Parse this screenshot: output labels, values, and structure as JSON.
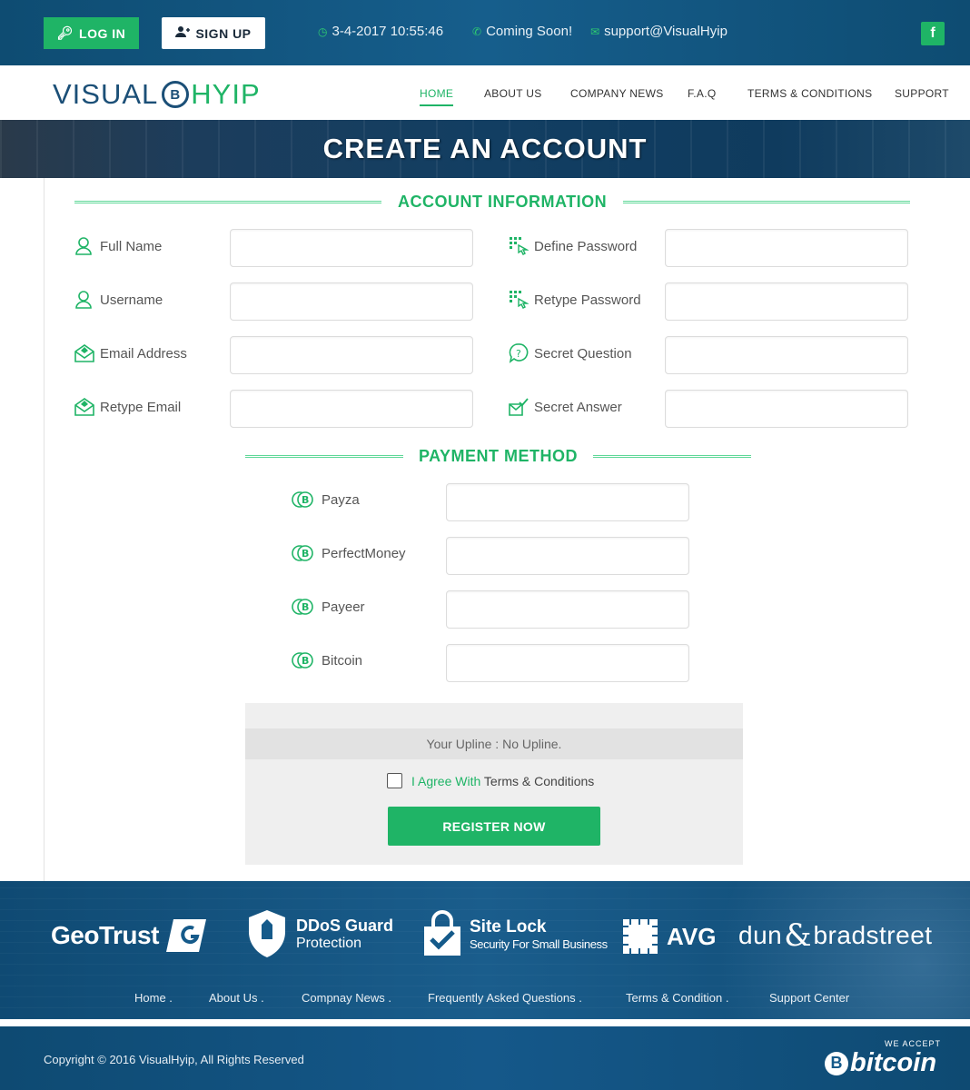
{
  "topbar": {
    "login_label": "LOG IN",
    "signup_label": "SIGN UP",
    "datetime": "3-4-2017 10:55:46",
    "phone": "Coming Soon!",
    "email": "support@VisualHyip",
    "facebook": "f"
  },
  "logo": {
    "part1": "VISUAL",
    "coin": "B",
    "part2": "HYIP"
  },
  "nav": {
    "home": "HOME",
    "about": "ABOUT US",
    "news": "COMPANY NEWS",
    "faq": "F.A.Q",
    "terms": "TERMS & CONDITIONS",
    "support": "SUPPORT"
  },
  "banner": {
    "title": "CREATE AN ACCOUNT"
  },
  "account_section": {
    "title": "ACCOUNT INFORMATION",
    "full_name": "Full Name",
    "username": "Username",
    "email": "Email Address",
    "retype_email": "Retype Email",
    "define_password": "Define Password",
    "retype_password": "Retype Password",
    "secret_question": "Secret Question",
    "secret_answer": "Secret Answer"
  },
  "payment_section": {
    "title": "PAYMENT METHOD",
    "payza": "Payza",
    "perfectmoney": "PerfectMoney",
    "payeer": "Payeer",
    "bitcoin": "Bitcoin"
  },
  "register": {
    "upline": "Your Upline : No Upline.",
    "agree_prefix": "I Agree With",
    "agree_link": "Terms & Conditions",
    "button": "REGISTER NOW"
  },
  "trust": {
    "geotrust": "GeoTrust",
    "ddos_title": "DDoS Guard",
    "ddos_sub": "Protection",
    "sitelock_title": "Site Lock",
    "sitelock_sub": "Security For Small Business",
    "avg": "AVG",
    "dnb_a": "dun",
    "dnb_b": "bradstreet"
  },
  "footer_links": {
    "home": "Home .",
    "about": "About Us .",
    "news": "Compnay News .",
    "faq": "Frequently Asked Questions .",
    "terms": "Terms & Condition .",
    "support": "Support Center"
  },
  "bottom": {
    "copyright": "Copyright © 2016 VisualHyip, All Rights Reserved",
    "we_accept": "WE ACCEPT",
    "btc_glyph": "B",
    "bitcoin": "bitcoin"
  }
}
